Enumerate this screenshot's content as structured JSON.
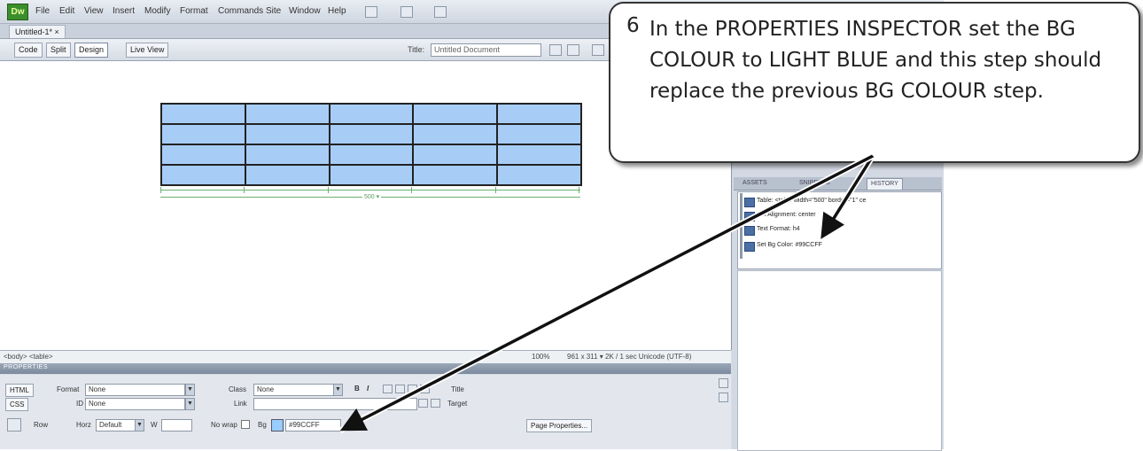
{
  "app": {
    "logo": "Dw",
    "menus": [
      "File",
      "Edit",
      "View",
      "Insert",
      "Modify",
      "Format",
      "Commands",
      "Site",
      "Window",
      "Help"
    ],
    "document_tab": "Untitled-1* ×"
  },
  "toolbar": {
    "code_label": "Code",
    "split_label": "Split",
    "design_label": "Design",
    "live_view_label": "Live View",
    "title_label": "Title:",
    "title_value": "Untitled Document"
  },
  "canvas": {
    "table_rows": 4,
    "table_cols": 5,
    "table_width_label": "500 ▾"
  },
  "statusbar": {
    "tag_selector": "<body> <table>",
    "zoom": "100%",
    "info": "961 x 311 ▾  2K / 1 sec  Unicode (UTF-8)"
  },
  "properties": {
    "title": "PROPERTIES",
    "html_btn": "HTML",
    "css_btn": "CSS",
    "format_label": "Format",
    "format_value": "None",
    "class_label": "Class",
    "class_value": "None",
    "id_label": "ID",
    "id_value": "None",
    "link_label": "Link",
    "title_label": "Title",
    "target_label": "Target",
    "row_label": "Row",
    "horz_label": "Horz",
    "horz_value": "Default",
    "w_label": "W",
    "nowrap_label": "No wrap",
    "bg_label": "Bg",
    "bg_value": "#99CCFF",
    "bold": "B",
    "italic": "I",
    "page_properties_btn": "Page Properties..."
  },
  "history": {
    "tabs": [
      "ASSETS",
      "SNIPPETS",
      "HISTORY"
    ],
    "items": [
      "Table: <table width=\"500\" border=\"1\" ce",
      "Set Alignment: center",
      "Text Format: h4",
      "Set Bg Color: #99CCFF"
    ]
  },
  "callout": {
    "number": "6",
    "text": "In the PROPERTIES INSPECTOR set the BG COLOUR to LIGHT BLUE and this step should replace the previous BG COLOUR step."
  },
  "colors": {
    "cell_fill": "#a7cdf7",
    "bg_color_value": "#99ccff"
  }
}
